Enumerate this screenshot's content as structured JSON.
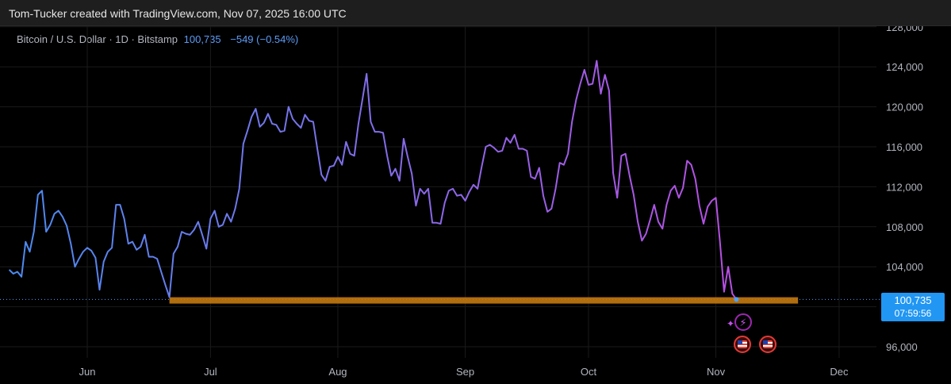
{
  "header": {
    "title": "Tom-Tucker created with TradingView.com, Nov 07, 2025 16:00 UTC"
  },
  "legend": {
    "symbol": "Bitcoin / U.S. Dollar · 1D · Bitstamp",
    "price": "100,735",
    "change": "−549 (−0.54%)"
  },
  "price_tag": {
    "price": "100,735",
    "countdown": "07:59:56"
  },
  "colors": {
    "background": "#000000",
    "line_start": "#4a8cf0",
    "line_end": "#cc44e0",
    "support_band": "#c47a10",
    "price_tag": "#2196f3",
    "grid": "#1a1a1a",
    "axis_text": "#b2b5be"
  },
  "events": {
    "bolt_icon": "lightning-icon",
    "flag_icon": "us-flag-icon"
  },
  "chart_data": {
    "type": "line",
    "title": "Bitcoin / U.S. Dollar · 1D · Bitstamp",
    "x_ticks": [
      "Jun",
      "Jul",
      "Aug",
      "Sep",
      "Oct",
      "Nov",
      "Dec"
    ],
    "y_ticks": [
      "96,000",
      "100,000",
      "104,000",
      "108,000",
      "112,000",
      "116,000",
      "120,000",
      "124,000",
      "128,000"
    ],
    "ylim": [
      95000,
      129000
    ],
    "y_axis_side": "right",
    "grid": true,
    "last_price": 100735,
    "support_band": {
      "from": 100350,
      "to": 100950,
      "start": "2025-06-21",
      "end": "2025-11-21"
    },
    "series": [
      {
        "x_start": "2025-05-13",
        "step": "1D",
        "values": [
          103700,
          103300,
          103500,
          103000,
          106500,
          105500,
          107500,
          111200,
          111600,
          107500,
          108200,
          109300,
          109600,
          109000,
          108100,
          106300,
          104000,
          104800,
          105500,
          105900,
          105600,
          104900,
          101700,
          104500,
          105500,
          105900,
          110200,
          110200,
          108800,
          106300,
          106500,
          105700,
          106000,
          107200,
          105000,
          105000,
          104800,
          103500,
          102200,
          100950,
          105300,
          106000,
          107500,
          107300,
          107200,
          107700,
          108500,
          107200,
          105800,
          108800,
          109600,
          108000,
          108200,
          109300,
          108500,
          109800,
          111800,
          116300,
          117600,
          119000,
          119800,
          118000,
          118400,
          119300,
          118300,
          118200,
          117500,
          117600,
          120000,
          118800,
          118300,
          117900,
          119200,
          118600,
          118500,
          115800,
          113200,
          112600,
          114000,
          114100,
          115000,
          114200,
          116500,
          115300,
          115100,
          118300,
          120800,
          123300,
          118500,
          117500,
          117500,
          117400,
          115100,
          113100,
          113800,
          112600,
          116800,
          115000,
          113300,
          110100,
          111800,
          111300,
          111800,
          108400,
          108400,
          108300,
          110400,
          111600,
          111800,
          111100,
          111200,
          110600,
          111500,
          112200,
          111800,
          114000,
          116000,
          116200,
          115900,
          115500,
          115600,
          116900,
          116400,
          117200,
          115800,
          115800,
          115600,
          113000,
          112800,
          113900,
          111100,
          109500,
          109800,
          111800,
          114400,
          114200,
          115300,
          118500,
          120700,
          122300,
          123700,
          122200,
          122300,
          124600,
          121300,
          123200,
          121600,
          113400,
          110900,
          115100,
          115300,
          113100,
          111200,
          108500,
          106600,
          107300,
          108700,
          110200,
          108500,
          107800,
          110200,
          111600,
          112100,
          110900,
          111900,
          114600,
          114200,
          112800,
          110100,
          108300,
          110000,
          110600,
          110900,
          106500,
          101500,
          104000,
          101300,
          100735
        ]
      }
    ]
  }
}
